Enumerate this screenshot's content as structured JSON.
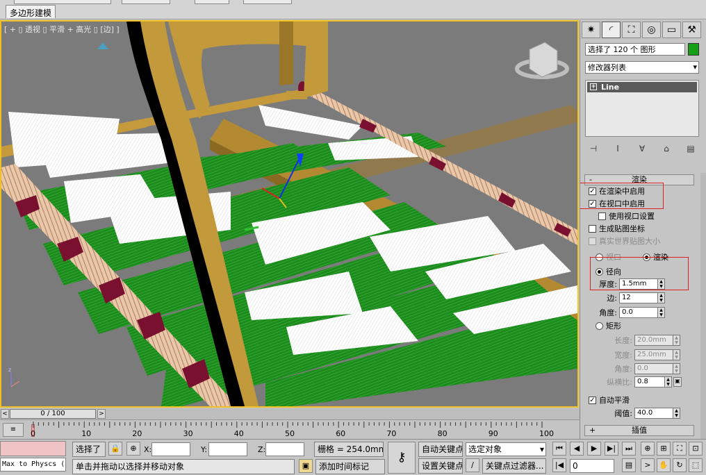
{
  "top_tab": "多边形建模",
  "viewport_label": "[ + ▯ 透视 ▯ 平滑 + 高光 ▯ [边] ]",
  "command_panel": {
    "selection_text": "选择了 120 个 图形",
    "object_color": "#14a014",
    "modifier_list": "修改器列表",
    "stack_item": "Line",
    "rollout_title": "渲染",
    "rollout_sign": "-",
    "enable_render": "在渲染中启用",
    "enable_viewport": "在视口中启用",
    "use_viewport_settings": "使用视口设置",
    "gen_mapping": "生成贴图坐标",
    "real_world_map": "真实世界贴图大小",
    "radio_viewport": "视口",
    "radio_render": "渲染",
    "radial": "径向",
    "thickness_label": "厚度:",
    "thickness_value": "1.5mm",
    "sides_label": "边:",
    "sides_value": "12",
    "angle_label": "角度:",
    "angle_value": "0.0",
    "rectangular": "矩形",
    "length_label": "长度:",
    "length_value": "20.0mm",
    "width_label": "宽度:",
    "width_value": "25.0mm",
    "angle2_label": "角度:",
    "angle2_value": "0.0",
    "aspect_label": "纵横比:",
    "aspect_value": "0.8",
    "auto_smooth": "自动平滑",
    "threshold_label": "阈值:",
    "threshold_value": "40.0",
    "next_rollout": "插值",
    "next_rollout_sign": "+"
  },
  "timeline": {
    "frame_display": "0 / 100",
    "left_arrow": "<",
    "right_arrow": ">",
    "ticks": [
      "0",
      "10",
      "20",
      "30",
      "40",
      "50",
      "60",
      "70",
      "80",
      "90",
      "100"
    ]
  },
  "status": {
    "script_text": "Max to Physcs (",
    "selected_label": "选择了",
    "x_label": "X:",
    "y_label": "Y:",
    "z_label": "Z:",
    "grid_text": "栅格 = 254.0mm",
    "auto_key": "自动关键点",
    "selected_object": "选定对象",
    "set_key": "设置关键点",
    "key_filters": "关键点过滤器...",
    "prompt": "单击并拖动以选择并移动对象",
    "add_time_tag": "添加时间标记",
    "frame_field": "0"
  }
}
